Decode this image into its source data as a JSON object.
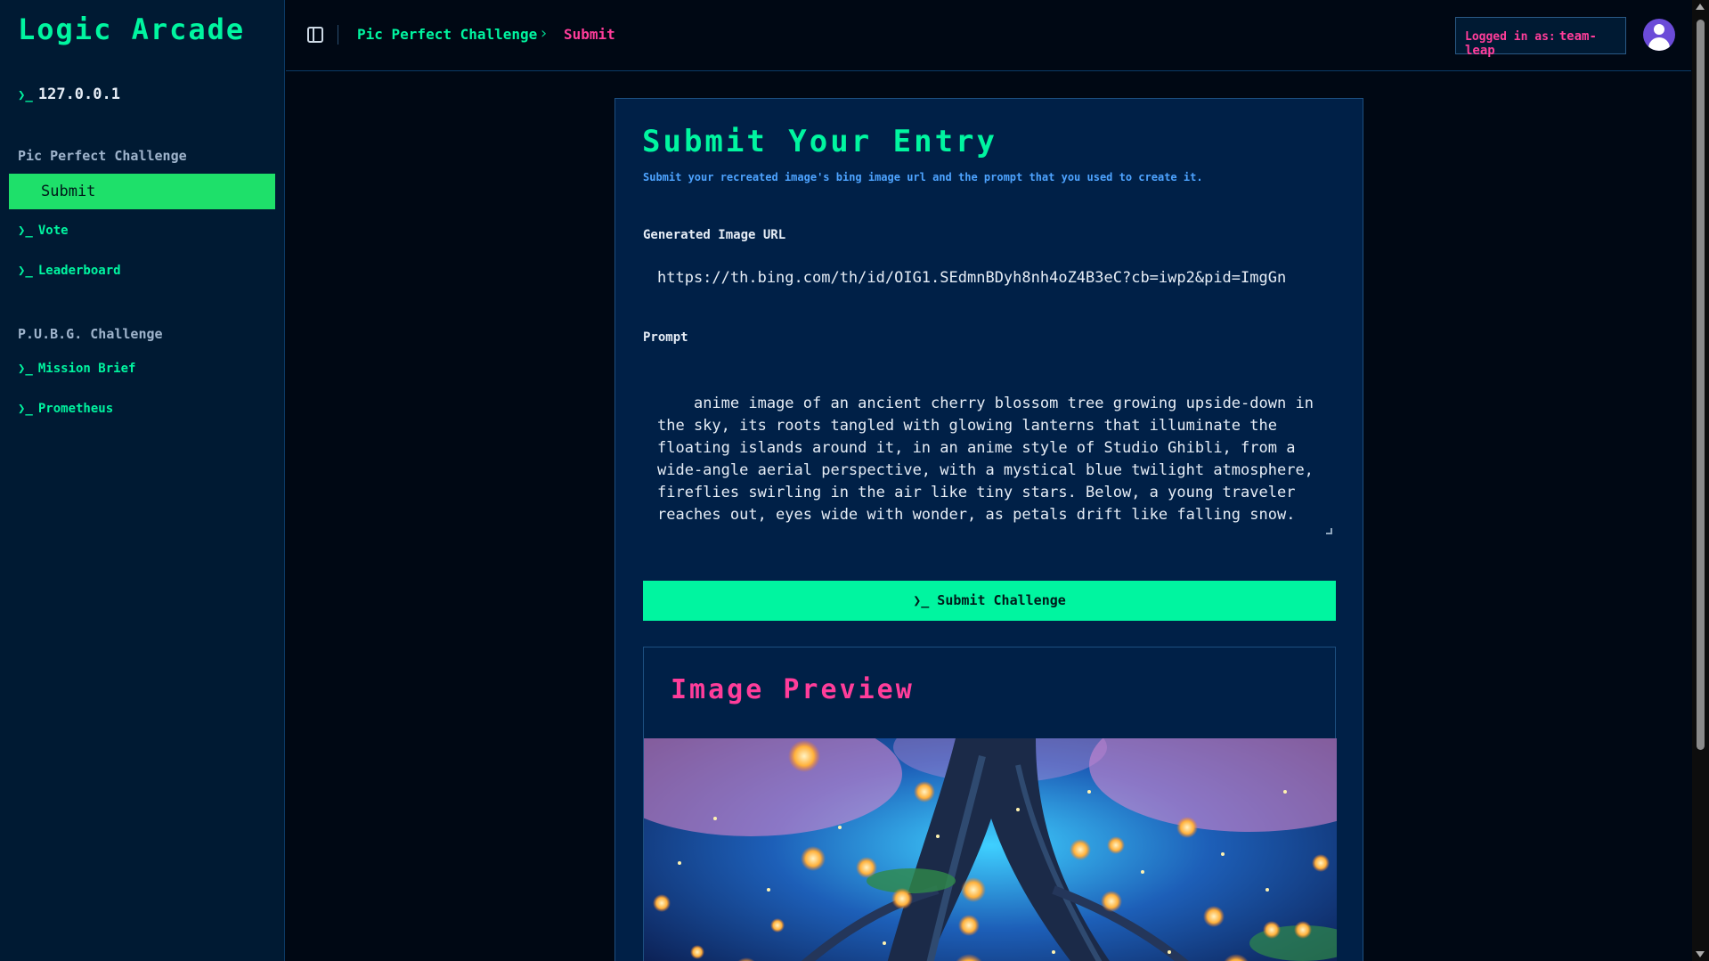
{
  "app": {
    "title": "Logic Arcade",
    "host": "127.0.0.1"
  },
  "sidebar": {
    "groups": [
      {
        "title": "Pic Perfect Challenge",
        "items": [
          {
            "label": "Submit",
            "active": true
          },
          {
            "label": "Vote"
          },
          {
            "label": "Leaderboard"
          }
        ]
      },
      {
        "title": "P.U.B.G. Challenge",
        "items": [
          {
            "label": "Mission Brief"
          },
          {
            "label": "Prometheus"
          }
        ]
      }
    ]
  },
  "header": {
    "breadcrumb": [
      "Pic Perfect Challenge",
      "Submit"
    ],
    "login_prefix": "Logged in as:",
    "login_user": "team-leap"
  },
  "form": {
    "title": "Submit Your Entry",
    "subtitle": "Submit your recreated image's bing image url and the prompt that you used to create it.",
    "url_label": "Generated Image URL",
    "url_value": "https://th.bing.com/th/id/OIG1.SEdmnBDyh8nh4oZ4B3eC?cb=iwp2&pid=ImgGn",
    "prompt_label": "Prompt",
    "prompt_value": "anime image of an ancient cherry blossom tree growing upside-down in the sky, its roots tangled with glowing lanterns that illuminate the floating islands around it, in an anime style of Studio Ghibli, from a wide-angle aerial perspective, with a mystical blue twilight atmosphere, fireflies swirling in the air like tiny stars. Below, a young traveler reaches out, eyes wide with wonder, as petals drift like falling snow.",
    "submit_label": "Submit Challenge"
  },
  "preview": {
    "title": "Image Preview"
  },
  "colors": {
    "accent": "#00f5a0",
    "pink": "#ff3d9a",
    "panel": "#002047",
    "sidebar": "#001a33"
  }
}
